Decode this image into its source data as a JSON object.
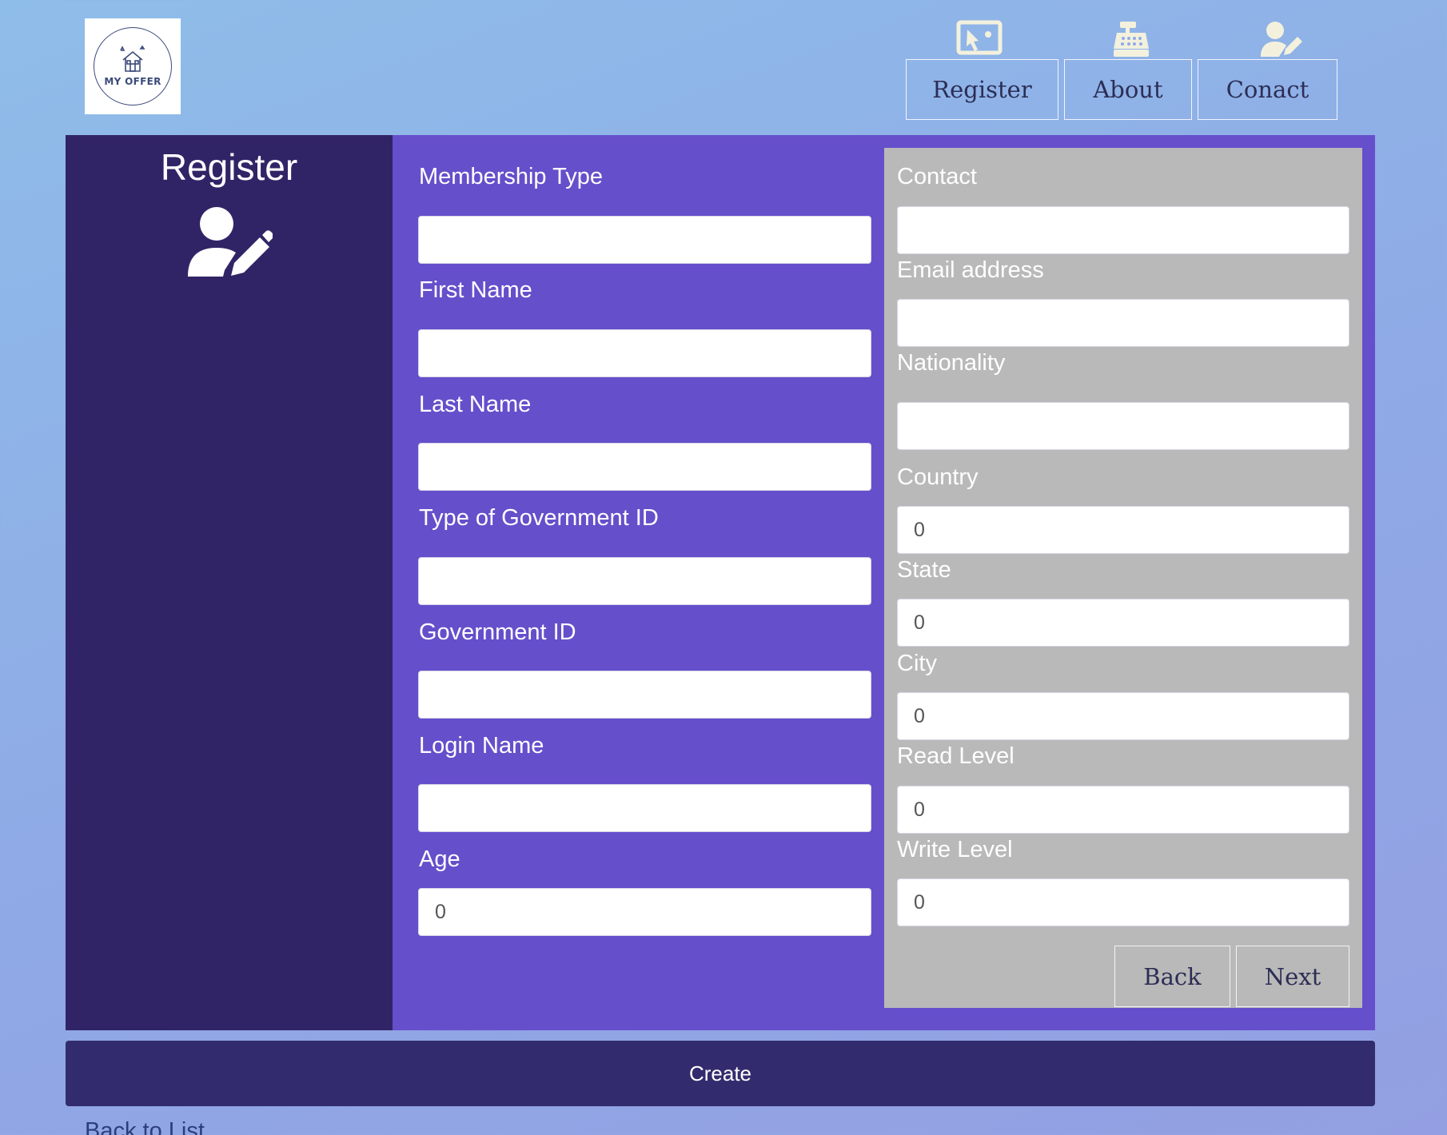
{
  "header": {
    "logo_text": "MY OFFER",
    "nav": [
      {
        "label": "Register",
        "icon": "monitor-pointer-icon"
      },
      {
        "label": "About",
        "icon": "cash-register-icon"
      },
      {
        "label": "Conact",
        "icon": "user-edit-icon"
      }
    ]
  },
  "sidebar": {
    "title": "Register",
    "icon": "user-edit-icon"
  },
  "form": {
    "left_fields": [
      {
        "label": "Membership Type",
        "value": ""
      },
      {
        "label": "First Name",
        "value": ""
      },
      {
        "label": "Last Name",
        "value": ""
      },
      {
        "label": "Type of Government ID",
        "value": ""
      },
      {
        "label": "Government ID",
        "value": ""
      },
      {
        "label": "Login Name",
        "value": ""
      },
      {
        "label": "Age",
        "value": "0"
      }
    ],
    "right_fields": [
      {
        "label": "Contact",
        "value": ""
      },
      {
        "label": "Email address",
        "value": ""
      },
      {
        "label": "Nationality",
        "value": ""
      },
      {
        "label": "Country",
        "value": "0"
      },
      {
        "label": "State",
        "value": "0"
      },
      {
        "label": "City",
        "value": "0"
      },
      {
        "label": "Read Level",
        "value": "0"
      },
      {
        "label": "Write Level",
        "value": "0"
      }
    ],
    "back_label": "Back",
    "next_label": "Next",
    "create_label": "Create",
    "back_to_list": "Back to List"
  },
  "colors": {
    "sidebar_bg": "#312466",
    "form_bg": "#664fcb",
    "card_bg": "#b9b9b9",
    "create_bg": "#322c6e"
  }
}
